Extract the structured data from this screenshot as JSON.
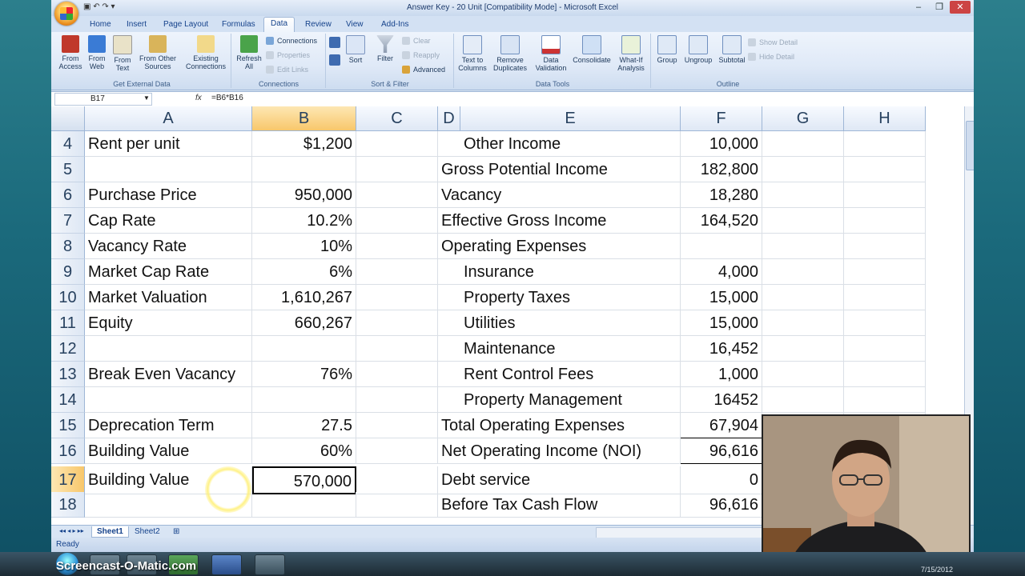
{
  "window": {
    "title": "Answer Key - 20 Unit  [Compatibility Mode] - Microsoft Excel"
  },
  "ribbon": {
    "tabs": [
      "Home",
      "Insert",
      "Page Layout",
      "Formulas",
      "Data",
      "Review",
      "View",
      "Add-Ins"
    ],
    "active_tab": "Data",
    "groups": {
      "get_external": {
        "label": "Get External Data",
        "buttons": [
          "From\nAccess",
          "From\nWeb",
          "From\nText",
          "From Other\nSources",
          "Existing\nConnections"
        ]
      },
      "connections": {
        "label": "Connections",
        "refresh": "Refresh\nAll",
        "small": [
          "Connections",
          "Properties",
          "Edit Links"
        ]
      },
      "sort_filter": {
        "label": "Sort & Filter",
        "sort": "Sort",
        "filter": "Filter",
        "small": [
          "Clear",
          "Reapply",
          "Advanced"
        ]
      },
      "data_tools": {
        "label": "Data Tools",
        "buttons": [
          "Text to\nColumns",
          "Remove\nDuplicates",
          "Data\nValidation",
          "Consolidate",
          "What-If\nAnalysis"
        ]
      },
      "outline": {
        "label": "Outline",
        "buttons": [
          "Group",
          "Ungroup",
          "Subtotal"
        ],
        "small": [
          "Show Detail",
          "Hide Detail"
        ]
      }
    }
  },
  "formula_bar": {
    "name_box": "B17",
    "fx": "fx",
    "formula": "=B6*B16"
  },
  "sheet": {
    "columns": [
      "A",
      "B",
      "C",
      "D",
      "E",
      "F",
      "G",
      "H"
    ],
    "selected_column": "B",
    "selected_row": "17",
    "rows": [
      {
        "n": "4",
        "a": "Rent per unit",
        "b": "$1,200",
        "e": "Other Income",
        "f": "10,000"
      },
      {
        "n": "5",
        "a": "",
        "b": "",
        "e": "Gross Potential Income",
        "f": "182,800"
      },
      {
        "n": "6",
        "a": "Purchase Price",
        "b": "950,000",
        "e": "Vacancy",
        "f": "18,280"
      },
      {
        "n": "7",
        "a": "Cap Rate",
        "b": "10.2%",
        "e": "Effective Gross Income",
        "f": "164,520"
      },
      {
        "n": "8",
        "a": "Vacancy Rate",
        "b": "10%",
        "e": "Operating Expenses",
        "f": ""
      },
      {
        "n": "9",
        "a": "Market Cap Rate",
        "b": "6%",
        "e": "Insurance",
        "f": "4,000"
      },
      {
        "n": "10",
        "a": "Market Valuation",
        "b": "1,610,267",
        "e": "Property Taxes",
        "f": "15,000"
      },
      {
        "n": "11",
        "a": "Equity",
        "b": "660,267",
        "e": "Utilities",
        "f": "15,000"
      },
      {
        "n": "12",
        "a": "",
        "b": "",
        "e": "Maintenance",
        "f": "16,452"
      },
      {
        "n": "13",
        "a": "Break Even Vacancy",
        "b": "76%",
        "e": "Rent Control Fees",
        "f": "1,000"
      },
      {
        "n": "14",
        "a": "",
        "b": "",
        "e": "Property Management",
        "f": "16452"
      },
      {
        "n": "15",
        "a": "Deprecation Term",
        "b": "27.5",
        "e": "Total Operating Expenses",
        "f": "67,904"
      },
      {
        "n": "16",
        "a": "Building Value",
        "b": "60%",
        "e": "Net Operating Income (NOI)",
        "f": "96,616"
      },
      {
        "n": "17",
        "a": "Building Value",
        "b": "570,000",
        "e": "Debt service",
        "f": "0"
      },
      {
        "n": "18",
        "a": "",
        "b": "",
        "e": "Before Tax Cash Flow",
        "f": "96,616"
      }
    ]
  },
  "sheet_tabs": [
    "Sheet1",
    "Sheet2"
  ],
  "status": "Ready",
  "taskbar": {
    "watermark": "Screencast-O-Matic.com",
    "clock": "7/15/2012"
  }
}
